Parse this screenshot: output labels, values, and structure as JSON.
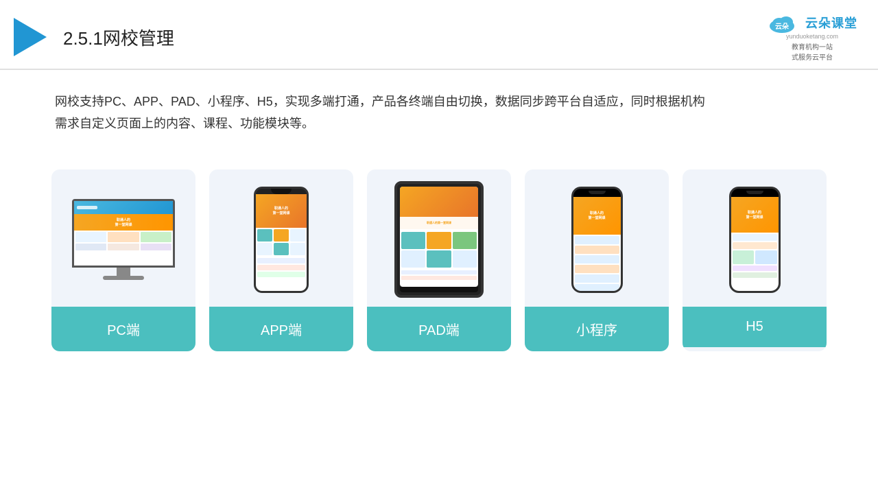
{
  "header": {
    "title_number": "2.5.1",
    "title_text": "网校管理",
    "brand_name": "云朵课堂",
    "brand_url": "yunduoketang.com",
    "brand_slogan": "教育机构一站",
    "brand_slogan2": "式服务云平台"
  },
  "description": {
    "text": "网校支持PC、APP、PAD、小程序、H5，实现多端打通，产品各终端自由切换，数据同步跨平台自适应，同时根据机构",
    "text2": "需求自定义页面上的内容、课程、功能模块等。"
  },
  "cards": [
    {
      "id": "pc",
      "label": "PC端"
    },
    {
      "id": "app",
      "label": "APP端"
    },
    {
      "id": "pad",
      "label": "PAD端"
    },
    {
      "id": "miniprogram",
      "label": "小程序"
    },
    {
      "id": "h5",
      "label": "H5"
    }
  ]
}
